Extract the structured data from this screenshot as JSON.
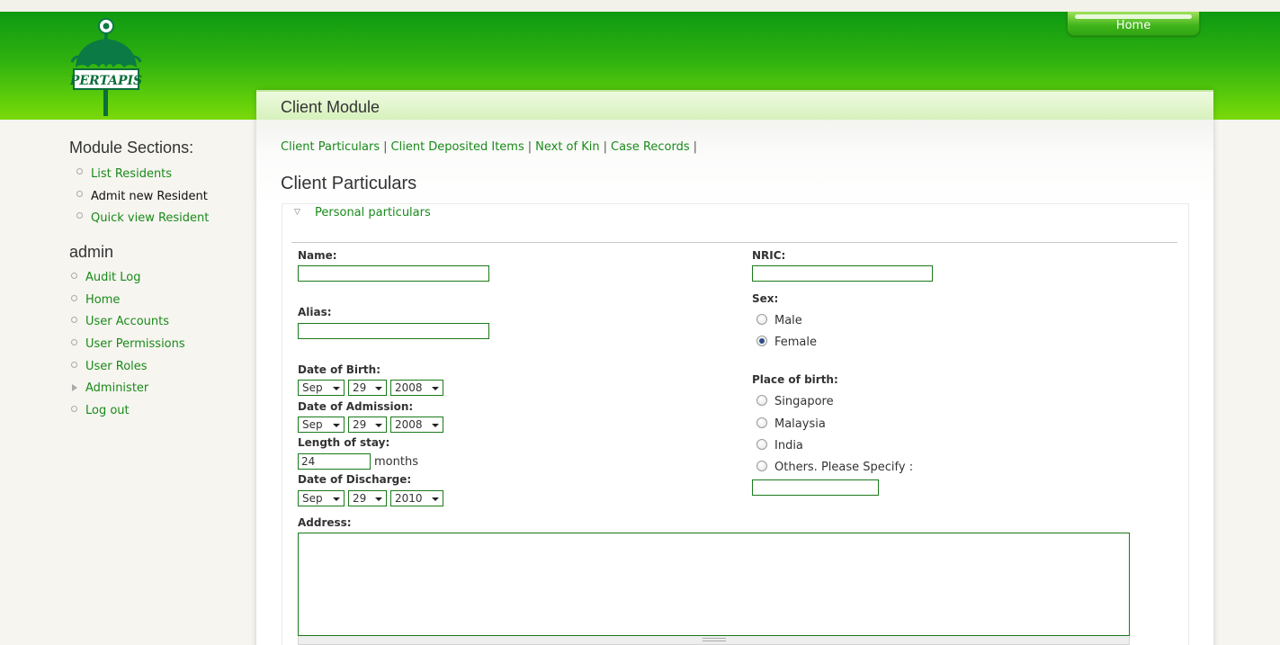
{
  "header": {
    "home_tab_label": "Home",
    "logo_text": "PERTAPIS"
  },
  "panel": {
    "title": "Client Module"
  },
  "tabs": [
    {
      "label": "Client Particulars"
    },
    {
      "label": "Client Deposited Items"
    },
    {
      "label": "Next of Kin"
    },
    {
      "label": "Case Records"
    }
  ],
  "tab_separator": "|",
  "section_title": "Client Particulars",
  "fieldset": {
    "legend": "Personal particulars",
    "collapse_icon": "triangle-down-icon"
  },
  "form": {
    "name": {
      "label": "Name:",
      "value": ""
    },
    "alias": {
      "label": "Alias:",
      "value": ""
    },
    "nric": {
      "label": "NRIC:",
      "value": ""
    },
    "sex": {
      "label": "Sex:",
      "options": [
        {
          "label": "Male",
          "checked": false
        },
        {
          "label": "Female",
          "checked": true
        }
      ]
    },
    "dob": {
      "label": "Date of Birth:",
      "month": "Sep",
      "day": "29",
      "year": "2008"
    },
    "doa": {
      "label": "Date of Admission:",
      "month": "Sep",
      "day": "29",
      "year": "2008"
    },
    "length_of_stay": {
      "label": "Length of stay:",
      "value": "24",
      "unit": "months"
    },
    "dod": {
      "label": "Date of Discharge:",
      "month": "Sep",
      "day": "29",
      "year": "2010"
    },
    "place_of_birth": {
      "label": "Place of birth:",
      "options": [
        {
          "label": "Singapore",
          "checked": false
        },
        {
          "label": "Malaysia",
          "checked": false
        },
        {
          "label": "India",
          "checked": false
        },
        {
          "label": "Others. Please Specify :",
          "checked": false
        }
      ],
      "others_value": ""
    },
    "address": {
      "label": "Address:",
      "value": ""
    }
  },
  "sidebar": {
    "module_sections_title": "Module Sections:",
    "module_items": [
      {
        "label": "List Residents",
        "active": false
      },
      {
        "label": "Admit new Resident",
        "active": true
      },
      {
        "label": "Quick view Resident",
        "active": false
      }
    ],
    "admin_title": "admin",
    "admin_items": [
      {
        "label": "Audit Log"
      },
      {
        "label": "Home"
      },
      {
        "label": "User Accounts"
      },
      {
        "label": "User Permissions"
      },
      {
        "label": "User Roles"
      },
      {
        "label": "Administer",
        "collapsed": true
      },
      {
        "label": "Log out"
      }
    ]
  },
  "colors": {
    "header_green_top": "#0e9a12",
    "header_green_bottom": "#7ad80a",
    "link_green": "#1a8a1a",
    "field_border": "#1a7a1a"
  }
}
